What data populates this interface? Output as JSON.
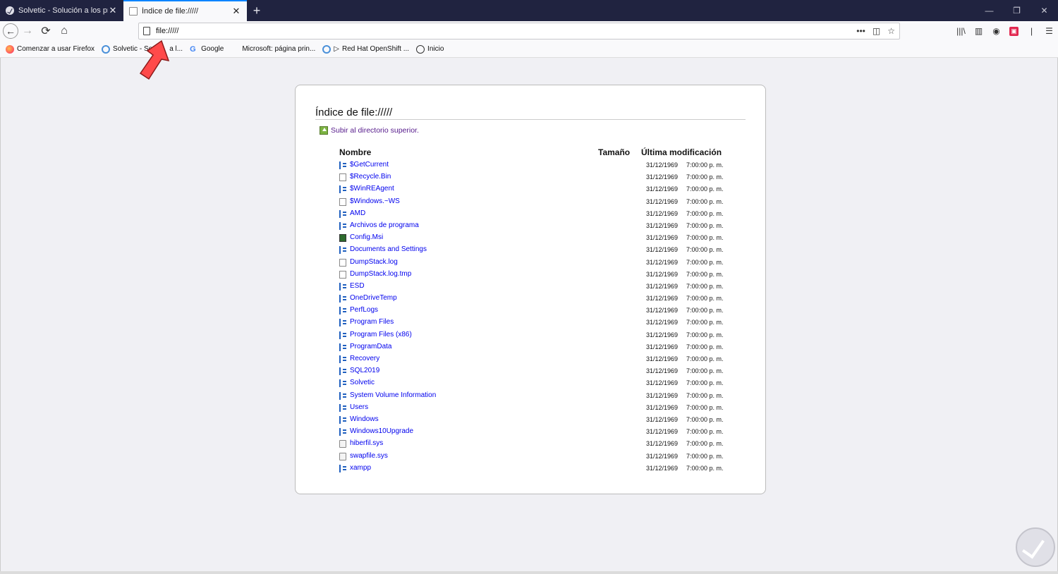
{
  "tabs": [
    {
      "title": "Solvetic - Solución a los proble",
      "active": false,
      "icon": "solvetic-icon"
    },
    {
      "title": "Índice de file://///",
      "active": true,
      "icon": "page-icon"
    }
  ],
  "window_controls": {
    "minimize": "—",
    "restore": "❐",
    "close": "✕"
  },
  "address": {
    "url": "file://///"
  },
  "bookmarks": [
    {
      "label": "Comenzar a usar Firefox",
      "icon": "firefox-icon"
    },
    {
      "label": "Solvetic - So",
      "icon": "search-icon"
    },
    {
      "label": "a l...",
      "icon": "none"
    },
    {
      "label": "Google",
      "icon": "google-icon"
    },
    {
      "label": "Microsoft: página prin...",
      "icon": "microsoft-icon"
    },
    {
      "label": "Red Hat OpenShift ...",
      "icon": "search-icon"
    },
    {
      "label": "Inicio",
      "icon": "globe-icon"
    }
  ],
  "listing": {
    "heading": "Índice de file://///",
    "up_link": "Subir al directorio superior.",
    "col_name": "Nombre",
    "col_size": "Tamaño",
    "col_modified": "Última modificación",
    "rows": [
      {
        "name": "$GetCurrent",
        "type": "dir",
        "date": "31/12/1969",
        "time": "7:00:00 p. m."
      },
      {
        "name": "$Recycle.Bin",
        "type": "file",
        "date": "31/12/1969",
        "time": "7:00:00 p. m."
      },
      {
        "name": "$WinREAgent",
        "type": "dir",
        "date": "31/12/1969",
        "time": "7:00:00 p. m."
      },
      {
        "name": "$Windows.~WS",
        "type": "file",
        "date": "31/12/1969",
        "time": "7:00:00 p. m."
      },
      {
        "name": "AMD",
        "type": "dir",
        "date": "31/12/1969",
        "time": "7:00:00 p. m."
      },
      {
        "name": "Archivos de programa",
        "type": "dir",
        "date": "31/12/1969",
        "time": "7:00:00 p. m."
      },
      {
        "name": "Config.Msi",
        "type": "cfg",
        "date": "31/12/1969",
        "time": "7:00:00 p. m."
      },
      {
        "name": "Documents and Settings",
        "type": "dir",
        "date": "31/12/1969",
        "time": "7:00:00 p. m."
      },
      {
        "name": "DumpStack.log",
        "type": "file",
        "date": "31/12/1969",
        "time": "7:00:00 p. m."
      },
      {
        "name": "DumpStack.log.tmp",
        "type": "file",
        "date": "31/12/1969",
        "time": "7:00:00 p. m."
      },
      {
        "name": "ESD",
        "type": "dir",
        "date": "31/12/1969",
        "time": "7:00:00 p. m."
      },
      {
        "name": "OneDriveTemp",
        "type": "dir",
        "date": "31/12/1969",
        "time": "7:00:00 p. m."
      },
      {
        "name": "PerfLogs",
        "type": "dir",
        "date": "31/12/1969",
        "time": "7:00:00 p. m."
      },
      {
        "name": "Program Files",
        "type": "dir",
        "date": "31/12/1969",
        "time": "7:00:00 p. m."
      },
      {
        "name": "Program Files (x86)",
        "type": "dir",
        "date": "31/12/1969",
        "time": "7:00:00 p. m."
      },
      {
        "name": "ProgramData",
        "type": "dir",
        "date": "31/12/1969",
        "time": "7:00:00 p. m."
      },
      {
        "name": "Recovery",
        "type": "dir",
        "date": "31/12/1969",
        "time": "7:00:00 p. m."
      },
      {
        "name": "SQL2019",
        "type": "dir",
        "date": "31/12/1969",
        "time": "7:00:00 p. m."
      },
      {
        "name": "Solvetic",
        "type": "dir",
        "date": "31/12/1969",
        "time": "7:00:00 p. m."
      },
      {
        "name": "System Volume Information",
        "type": "dir",
        "date": "31/12/1969",
        "time": "7:00:00 p. m."
      },
      {
        "name": "Users",
        "type": "dir",
        "date": "31/12/1969",
        "time": "7:00:00 p. m."
      },
      {
        "name": "Windows",
        "type": "dir",
        "date": "31/12/1969",
        "time": "7:00:00 p. m."
      },
      {
        "name": "Windows10Upgrade",
        "type": "dir",
        "date": "31/12/1969",
        "time": "7:00:00 p. m."
      },
      {
        "name": "hiberfil.sys",
        "type": "sys",
        "date": "31/12/1969",
        "time": "7:00:00 p. m."
      },
      {
        "name": "swapfile.sys",
        "type": "sys",
        "date": "31/12/1969",
        "time": "7:00:00 p. m."
      },
      {
        "name": "xampp",
        "type": "dir",
        "date": "31/12/1969",
        "time": "7:00:00 p. m."
      }
    ]
  },
  "colors": {
    "tabstrip": "#202340",
    "link": "#0000ee",
    "visited": "#551a8b",
    "arrow": "#ff4a4a"
  }
}
